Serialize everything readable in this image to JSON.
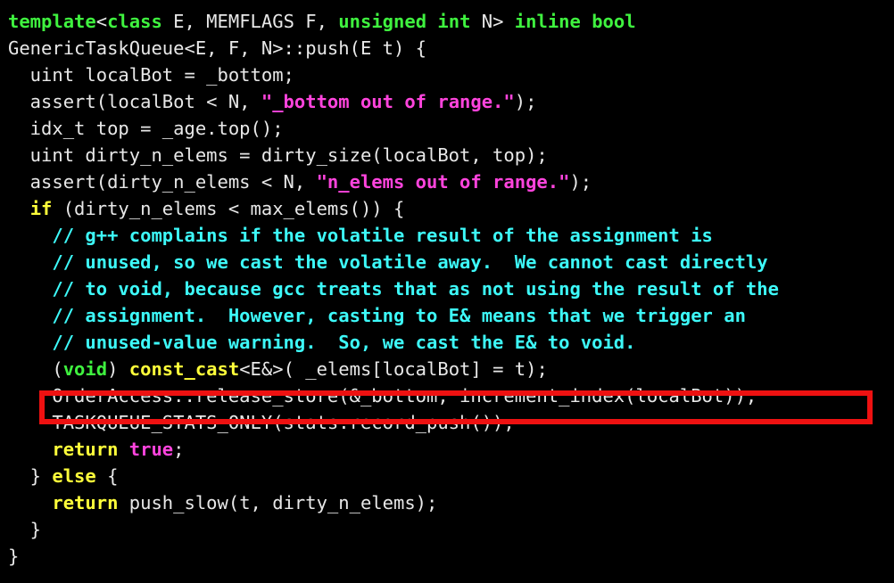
{
  "editor": {
    "background_color": "#000000",
    "default_text_color": "#e8e8e8",
    "font_size_px": 20.5,
    "line_height_px": 30,
    "language": "C++"
  },
  "palette": {
    "keyword": "#ffff3a",
    "type": "#3ff23f",
    "string": "#ff44dd",
    "literal": "#ff44dd",
    "comment": "#3df9f9",
    "plain": "#e8e8e8",
    "highlight_box": "#ee1111"
  },
  "annotation": {
    "type": "rectangle",
    "color": "#ee1111",
    "target_line_index": 14,
    "target_line_text": "OrderAccess::release_store(&_bottom, increment_index(localBot));"
  },
  "code": {
    "lines": [
      {
        "index": 0,
        "tokens": [
          {
            "text": "template",
            "kind": "type"
          },
          {
            "text": "<",
            "kind": "plain"
          },
          {
            "text": "class",
            "kind": "type"
          },
          {
            "text": " E, MEMFLAGS F, ",
            "kind": "plain"
          },
          {
            "text": "unsigned",
            "kind": "type"
          },
          {
            "text": " ",
            "kind": "plain"
          },
          {
            "text": "int",
            "kind": "type"
          },
          {
            "text": " N> ",
            "kind": "plain"
          },
          {
            "text": "inline",
            "kind": "type"
          },
          {
            "text": " ",
            "kind": "plain"
          },
          {
            "text": "bool",
            "kind": "type"
          }
        ]
      },
      {
        "index": 1,
        "tokens": [
          {
            "text": "GenericTaskQueue<E, F, N>::push(E t) {",
            "kind": "plain"
          }
        ]
      },
      {
        "index": 2,
        "tokens": [
          {
            "text": "  uint localBot = _bottom;",
            "kind": "plain"
          }
        ]
      },
      {
        "index": 3,
        "tokens": [
          {
            "text": "  assert(localBot < N, ",
            "kind": "plain"
          },
          {
            "text": "\"_bottom out of range.\"",
            "kind": "string"
          },
          {
            "text": ");",
            "kind": "plain"
          }
        ]
      },
      {
        "index": 4,
        "tokens": [
          {
            "text": "  idx_t top = _age.top();",
            "kind": "plain"
          }
        ]
      },
      {
        "index": 5,
        "tokens": [
          {
            "text": "  uint dirty_n_elems = dirty_size(localBot, top);",
            "kind": "plain"
          }
        ]
      },
      {
        "index": 6,
        "tokens": [
          {
            "text": "  assert(dirty_n_elems < N, ",
            "kind": "plain"
          },
          {
            "text": "\"n_elems out of range.\"",
            "kind": "string"
          },
          {
            "text": ");",
            "kind": "plain"
          }
        ]
      },
      {
        "index": 7,
        "tokens": [
          {
            "text": "  ",
            "kind": "plain"
          },
          {
            "text": "if",
            "kind": "keyword"
          },
          {
            "text": " (dirty_n_elems < max_elems()) {",
            "kind": "plain"
          }
        ]
      },
      {
        "index": 8,
        "tokens": [
          {
            "text": "    // g++ complains if the volatile result of the assignment is",
            "kind": "comment"
          }
        ]
      },
      {
        "index": 9,
        "tokens": [
          {
            "text": "    // unused, so we cast the volatile away.  We cannot cast directly",
            "kind": "comment"
          }
        ]
      },
      {
        "index": 10,
        "tokens": [
          {
            "text": "    // to void, because gcc treats that as not using the result of the",
            "kind": "comment"
          }
        ]
      },
      {
        "index": 11,
        "tokens": [
          {
            "text": "    // assignment.  However, casting to E& means that we trigger an",
            "kind": "comment"
          }
        ]
      },
      {
        "index": 12,
        "tokens": [
          {
            "text": "    // unused-value warning.  So, we cast the E& to void.",
            "kind": "comment"
          }
        ]
      },
      {
        "index": 13,
        "tokens": [
          {
            "text": "    (",
            "kind": "plain"
          },
          {
            "text": "void",
            "kind": "type"
          },
          {
            "text": ") ",
            "kind": "plain"
          },
          {
            "text": "const_cast",
            "kind": "keyword"
          },
          {
            "text": "<E&>( _elems[localBot] = t);",
            "kind": "plain"
          }
        ]
      },
      {
        "index": 14,
        "tokens": [
          {
            "text": "    OrderAccess::release_store(&_bottom, increment_index(localBot));",
            "kind": "plain"
          }
        ]
      },
      {
        "index": 15,
        "tokens": [
          {
            "text": "    TASKQUEUE_STATS_ONLY(stats.record_push());",
            "kind": "plain"
          }
        ]
      },
      {
        "index": 16,
        "tokens": [
          {
            "text": "    ",
            "kind": "plain"
          },
          {
            "text": "return",
            "kind": "keyword"
          },
          {
            "text": " ",
            "kind": "plain"
          },
          {
            "text": "true",
            "kind": "literal"
          },
          {
            "text": ";",
            "kind": "plain"
          }
        ]
      },
      {
        "index": 17,
        "tokens": [
          {
            "text": "  } ",
            "kind": "plain"
          },
          {
            "text": "else",
            "kind": "keyword"
          },
          {
            "text": " {",
            "kind": "plain"
          }
        ]
      },
      {
        "index": 18,
        "tokens": [
          {
            "text": "    ",
            "kind": "plain"
          },
          {
            "text": "return",
            "kind": "keyword"
          },
          {
            "text": " push_slow(t, dirty_n_elems);",
            "kind": "plain"
          }
        ]
      },
      {
        "index": 19,
        "tokens": [
          {
            "text": "  }",
            "kind": "plain"
          }
        ]
      },
      {
        "index": 20,
        "tokens": [
          {
            "text": "}",
            "kind": "plain"
          }
        ]
      }
    ]
  }
}
